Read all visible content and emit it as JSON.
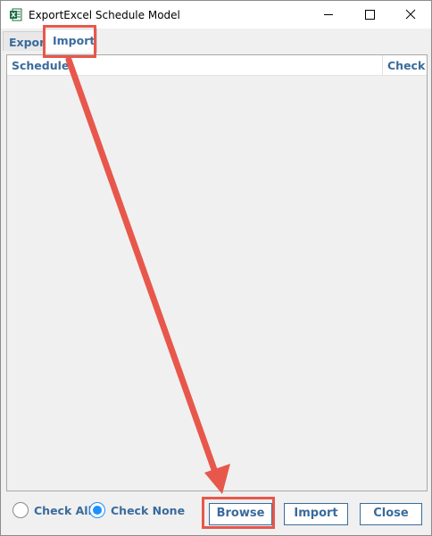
{
  "window": {
    "title": "ExportExcel Schedule Model",
    "icon": "excel-icon",
    "controls": [
      "minimize-icon",
      "maximize-icon",
      "close-icon"
    ]
  },
  "tabs": [
    {
      "label": "Export",
      "active": false
    },
    {
      "label": "Import",
      "active": true
    }
  ],
  "grid": {
    "columns": [
      "Schedule",
      "Check"
    ],
    "rows": []
  },
  "footer": {
    "radio_check_all": "Check All",
    "radio_check_none": "Check None",
    "selected_radio": "Check None",
    "browse_label": "Browse",
    "import_label": "Import",
    "close_label": "Close"
  },
  "colors": {
    "accent_text": "#3a6b9c",
    "annotation_red": "#e8574b",
    "radio_selected": "#1e90ff"
  }
}
